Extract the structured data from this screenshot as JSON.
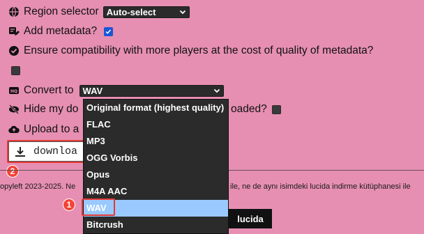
{
  "settings": {
    "region": {
      "label": "Region selector",
      "value": "Auto-select"
    },
    "metadata": {
      "label": "Add metadata?",
      "checked": true
    },
    "compat": {
      "label": "Ensure compatibility with more players at the cost of quality of metadata?",
      "checked": false
    },
    "convert": {
      "label": "Convert to",
      "value": "WAV"
    },
    "hide_prefix": "Hide my do",
    "hide_suffix": "oaded?",
    "upload_prefix": "Upload to a"
  },
  "download_button": {
    "label": "downloa"
  },
  "format_options": [
    "Original format (highest quality)",
    "FLAC",
    "MP3",
    "OGG Vorbis",
    "Opus",
    "M4A AAC",
    "WAV",
    "Bitcrush"
  ],
  "selected_format": "WAV",
  "footer": {
    "left": "opyleft 2023-2025. Ne",
    "right": "ile, ne de aynı isimdeki lucida indirme kütüphanesi ile",
    "logo": "lucida"
  },
  "annotations": {
    "badge_1": "1",
    "badge_2": "2"
  }
}
